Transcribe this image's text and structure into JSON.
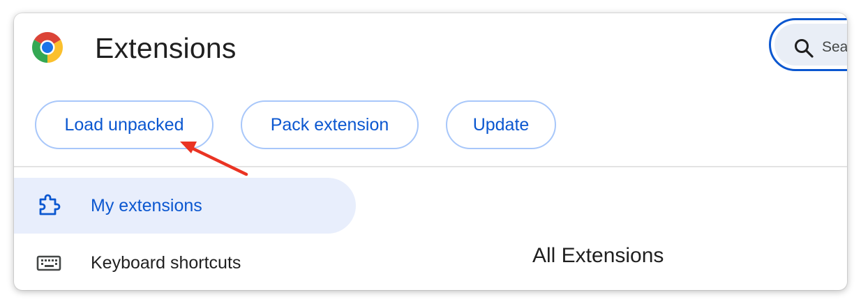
{
  "header": {
    "title": "Extensions",
    "logo_icon": "chrome-logo-icon"
  },
  "search": {
    "placeholder": "Search extensions",
    "icon": "search-icon",
    "accent_color": "#0b57d0"
  },
  "toolbar": {
    "load_unpacked_label": "Load unpacked",
    "pack_extension_label": "Pack extension",
    "update_label": "Update"
  },
  "sidebar": {
    "items": [
      {
        "label": "My extensions",
        "icon": "puzzle-piece-icon",
        "selected": true
      },
      {
        "label": "Keyboard shortcuts",
        "icon": "keyboard-icon",
        "selected": false
      }
    ]
  },
  "main": {
    "section_title": "All Extensions"
  },
  "annotation": {
    "arrow_color": "#ea3323",
    "points_to": "load-unpacked-button"
  },
  "colors": {
    "accent": "#0b57d0",
    "button_border": "#a8c7fa",
    "selected_bg": "#e8eefc",
    "text_primary": "#1f1f1f"
  }
}
